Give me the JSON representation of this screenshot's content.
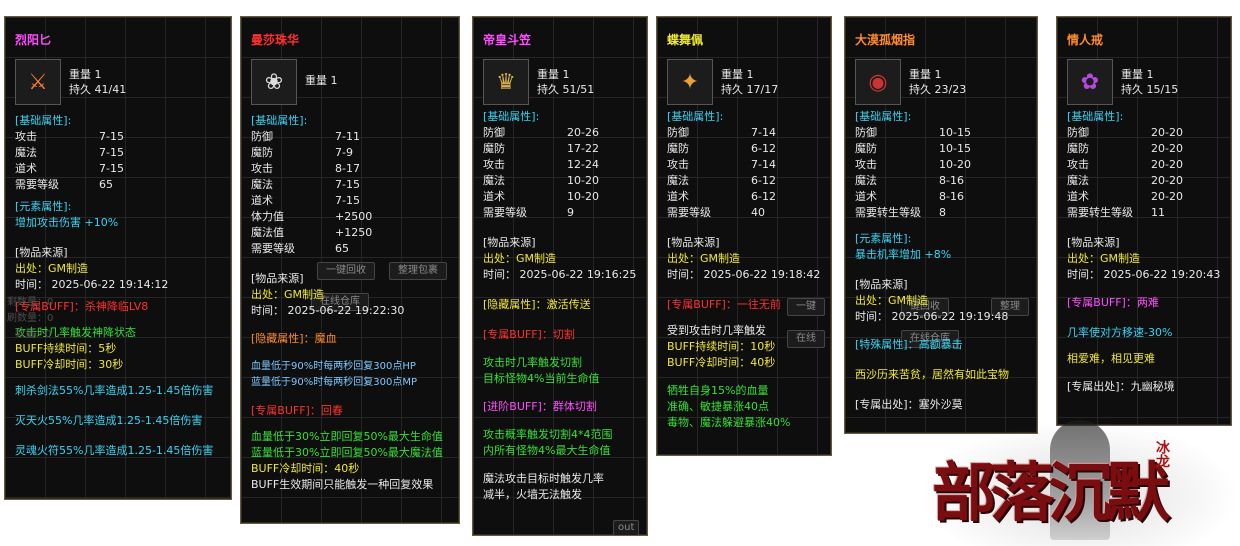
{
  "colors": {
    "panel_bg": "#0e0e0e",
    "border": "#6b5a3a",
    "cyan": "#38d3f2",
    "yellow": "#f0e830",
    "red": "#ff3030",
    "orange": "#ff8a2b",
    "magenta": "#ff4cff",
    "green": "#36e036"
  },
  "p1": {
    "title": "烈阳匕",
    "icon": "dagger-icon",
    "weight": "重量  1",
    "dur": "持久  41/41",
    "base_hdr": "[基础属性]:",
    "stats": [
      [
        "攻击",
        "7-15"
      ],
      [
        "魔法",
        "7-15"
      ],
      [
        "道术",
        "7-15"
      ],
      [
        "需要等级",
        "65"
      ]
    ],
    "elem_hdr": "[元素属性]:",
    "elem": "增加攻击伤害   +10%",
    "src_hdr": "[物品来源]",
    "src": "出处：GM制造",
    "time": "时间：  2025-06-22  19:14:12",
    "buff": "[专属BUFF]：杀神降临LV8",
    "b1": "攻击时几率触发神降状态",
    "b2": "BUFF持续时间：5秒",
    "b3": "BUFF冷却时间：30秒",
    "s1": "刺杀剑法55%几率造成1.25-1.45倍伤害",
    "s2": "灭天火55%几率造成1.25-1.45倍伤害",
    "s3": "灵魂火符55%几率造成1.25-1.45倍伤害",
    "g1": "剩数量：0",
    "g2": "刷数量：0",
    "g3": "数量：0"
  },
  "p2": {
    "title": "曼莎珠华",
    "icon": "rose-icon",
    "weight": "重量  1",
    "base_hdr": "[基础属性]:",
    "stats": [
      [
        "防御",
        "7-11"
      ],
      [
        "魔防",
        "7-9"
      ],
      [
        "攻击",
        "8-17"
      ],
      [
        "魔法",
        "7-15"
      ],
      [
        "道术",
        "7-15"
      ],
      [
        "体力值",
        "+2500"
      ],
      [
        "魔法值",
        "+1250"
      ],
      [
        "需要等级",
        "65"
      ]
    ],
    "src_hdr": "[物品来源]",
    "src": "出处：GM制造",
    "time": "时间：  2025-06-22  19:22:30",
    "hidden": "[隐藏属性]：魔血",
    "h1": "血量低于90%时每两秒回复300点HP",
    "h2": "蓝量低于90%时每两秒回复300点MP",
    "buff": "[专属BUFF]：回春",
    "r1": "血量低于30%立即回复50%最大生命值",
    "r2": "蓝量低于30%立即回复50%最大魔法值",
    "r3": "BUFF冷却时间：40秒",
    "r4": "BUFF生效期间只能触发一种回复效果",
    "g1": "一键回收",
    "g2": "整理包裹",
    "g3": "在线仓库"
  },
  "p3": {
    "title": "帝皇斗笠",
    "icon": "hat-icon",
    "weight": "重量  1",
    "dur": "持久  51/51",
    "base_hdr": "[基础属性]:",
    "stats": [
      [
        "防御",
        "20-26"
      ],
      [
        "魔防",
        "17-22"
      ],
      [
        "攻击",
        "12-24"
      ],
      [
        "魔法",
        "10-20"
      ],
      [
        "道术",
        "10-20"
      ],
      [
        "需要等级",
        "9"
      ]
    ],
    "src_hdr": "[物品来源]",
    "src": "出处：GM制造",
    "time": "时间：  2025-06-22  19:16:25",
    "hidden": "[隐藏属性]：激活传送",
    "buff": "[专属BUFF]：切割",
    "c1": "攻击时几率触发切割",
    "c2": "目标怪物4%当前生命值",
    "adv": "[进阶BUFF]：群体切割",
    "a1": "攻击概率触发切割4*4范围",
    "a2": "内所有怪物4%最大生命值",
    "m1": "魔法攻击目标时触发几率",
    "m2": "减半，火墙无法触发",
    "g1": "out"
  },
  "p4": {
    "title": "蝶舞佩",
    "icon": "butterfly-icon",
    "weight": "重量  1",
    "dur": "持久  17/17",
    "base_hdr": "[基础属性]:",
    "stats": [
      [
        "防御",
        "7-14"
      ],
      [
        "魔防",
        "6-12"
      ],
      [
        "攻击",
        "7-14"
      ],
      [
        "魔法",
        "6-12"
      ],
      [
        "道术",
        "6-12"
      ],
      [
        "需要等级",
        "40"
      ]
    ],
    "src_hdr": "[物品来源]",
    "src": "出处：GM制造",
    "time": "时间：  2025-06-22  19:18:42",
    "buff": "[专属BUFF]：一往无前",
    "d1": "受到攻击时几率触发",
    "d2": "BUFF持续时间：10秒",
    "d3": "BUFF冷却时间：40秒",
    "e1": "牺牲自身15%的血量",
    "e2": "准确、敏捷暴涨40点",
    "e3": "毒物、魔法躲避暴涨40%",
    "g1": "一键",
    "g2": "在线"
  },
  "p5": {
    "title": "大漠孤烟指",
    "icon": "ring-icon",
    "weight": "重量  1",
    "dur": "持久  23/23",
    "base_hdr": "[基础属性]:",
    "stats": [
      [
        "防御",
        "10-15"
      ],
      [
        "魔防",
        "10-15"
      ],
      [
        "攻击",
        "10-20"
      ],
      [
        "魔法",
        "8-16"
      ],
      [
        "道术",
        "8-16"
      ],
      [
        "需要转生等级",
        "8"
      ]
    ],
    "elem_hdr": "[元素属性]:",
    "elem": "暴击机率增加   +8%",
    "src_hdr": "[物品来源]",
    "src": "出处：GM制造",
    "time": "时间：  2025-06-22  19:19:48",
    "special": "[特殊属性]：高额暴击",
    "quote": "西沙历来苦贫，居然有如此宝物",
    "exsrc": "[专属出处]：塞外沙莫",
    "g1": "键回收",
    "g2": "整理",
    "g3": "在线仓库"
  },
  "p6": {
    "title": "情人戒",
    "icon": "flower-ring-icon",
    "weight": "重量  1",
    "dur": "持久  15/15",
    "base_hdr": "[基础属性]:",
    "stats": [
      [
        "防御",
        "20-20"
      ],
      [
        "魔防",
        "20-20"
      ],
      [
        "攻击",
        "20-20"
      ],
      [
        "魔法",
        "20-20"
      ],
      [
        "道术",
        "20-20"
      ],
      [
        "需要转生等级",
        "11"
      ]
    ],
    "src_hdr": "[物品来源]",
    "src": "出处：GM制造",
    "time": "时间：  2025-06-22  19:20:43",
    "buff": "[专属BUFF]：两难",
    "f1": "几率使对方移速-30%",
    "f2": "相爱难，相见更难",
    "exsrc": "[专属出处]：九幽秘境"
  },
  "logo": {
    "text": "部落沉默",
    "sub": "冰龙"
  }
}
